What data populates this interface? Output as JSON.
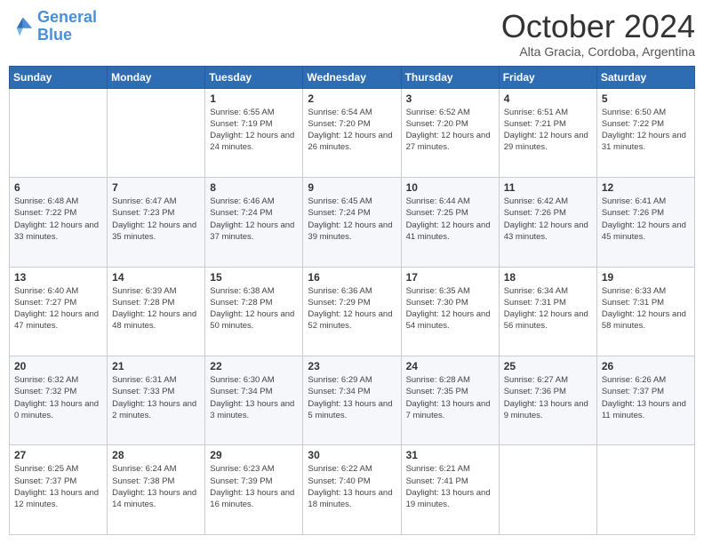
{
  "logo": {
    "line1": "General",
    "line2": "Blue"
  },
  "header": {
    "month": "October 2024",
    "location": "Alta Gracia, Cordoba, Argentina"
  },
  "weekdays": [
    "Sunday",
    "Monday",
    "Tuesday",
    "Wednesday",
    "Thursday",
    "Friday",
    "Saturday"
  ],
  "weeks": [
    [
      {
        "day": "",
        "info": ""
      },
      {
        "day": "",
        "info": ""
      },
      {
        "day": "1",
        "info": "Sunrise: 6:55 AM\nSunset: 7:19 PM\nDaylight: 12 hours and 24 minutes."
      },
      {
        "day": "2",
        "info": "Sunrise: 6:54 AM\nSunset: 7:20 PM\nDaylight: 12 hours and 26 minutes."
      },
      {
        "day": "3",
        "info": "Sunrise: 6:52 AM\nSunset: 7:20 PM\nDaylight: 12 hours and 27 minutes."
      },
      {
        "day": "4",
        "info": "Sunrise: 6:51 AM\nSunset: 7:21 PM\nDaylight: 12 hours and 29 minutes."
      },
      {
        "day": "5",
        "info": "Sunrise: 6:50 AM\nSunset: 7:22 PM\nDaylight: 12 hours and 31 minutes."
      }
    ],
    [
      {
        "day": "6",
        "info": "Sunrise: 6:48 AM\nSunset: 7:22 PM\nDaylight: 12 hours and 33 minutes."
      },
      {
        "day": "7",
        "info": "Sunrise: 6:47 AM\nSunset: 7:23 PM\nDaylight: 12 hours and 35 minutes."
      },
      {
        "day": "8",
        "info": "Sunrise: 6:46 AM\nSunset: 7:24 PM\nDaylight: 12 hours and 37 minutes."
      },
      {
        "day": "9",
        "info": "Sunrise: 6:45 AM\nSunset: 7:24 PM\nDaylight: 12 hours and 39 minutes."
      },
      {
        "day": "10",
        "info": "Sunrise: 6:44 AM\nSunset: 7:25 PM\nDaylight: 12 hours and 41 minutes."
      },
      {
        "day": "11",
        "info": "Sunrise: 6:42 AM\nSunset: 7:26 PM\nDaylight: 12 hours and 43 minutes."
      },
      {
        "day": "12",
        "info": "Sunrise: 6:41 AM\nSunset: 7:26 PM\nDaylight: 12 hours and 45 minutes."
      }
    ],
    [
      {
        "day": "13",
        "info": "Sunrise: 6:40 AM\nSunset: 7:27 PM\nDaylight: 12 hours and 47 minutes."
      },
      {
        "day": "14",
        "info": "Sunrise: 6:39 AM\nSunset: 7:28 PM\nDaylight: 12 hours and 48 minutes."
      },
      {
        "day": "15",
        "info": "Sunrise: 6:38 AM\nSunset: 7:28 PM\nDaylight: 12 hours and 50 minutes."
      },
      {
        "day": "16",
        "info": "Sunrise: 6:36 AM\nSunset: 7:29 PM\nDaylight: 12 hours and 52 minutes."
      },
      {
        "day": "17",
        "info": "Sunrise: 6:35 AM\nSunset: 7:30 PM\nDaylight: 12 hours and 54 minutes."
      },
      {
        "day": "18",
        "info": "Sunrise: 6:34 AM\nSunset: 7:31 PM\nDaylight: 12 hours and 56 minutes."
      },
      {
        "day": "19",
        "info": "Sunrise: 6:33 AM\nSunset: 7:31 PM\nDaylight: 12 hours and 58 minutes."
      }
    ],
    [
      {
        "day": "20",
        "info": "Sunrise: 6:32 AM\nSunset: 7:32 PM\nDaylight: 13 hours and 0 minutes."
      },
      {
        "day": "21",
        "info": "Sunrise: 6:31 AM\nSunset: 7:33 PM\nDaylight: 13 hours and 2 minutes."
      },
      {
        "day": "22",
        "info": "Sunrise: 6:30 AM\nSunset: 7:34 PM\nDaylight: 13 hours and 3 minutes."
      },
      {
        "day": "23",
        "info": "Sunrise: 6:29 AM\nSunset: 7:34 PM\nDaylight: 13 hours and 5 minutes."
      },
      {
        "day": "24",
        "info": "Sunrise: 6:28 AM\nSunset: 7:35 PM\nDaylight: 13 hours and 7 minutes."
      },
      {
        "day": "25",
        "info": "Sunrise: 6:27 AM\nSunset: 7:36 PM\nDaylight: 13 hours and 9 minutes."
      },
      {
        "day": "26",
        "info": "Sunrise: 6:26 AM\nSunset: 7:37 PM\nDaylight: 13 hours and 11 minutes."
      }
    ],
    [
      {
        "day": "27",
        "info": "Sunrise: 6:25 AM\nSunset: 7:37 PM\nDaylight: 13 hours and 12 minutes."
      },
      {
        "day": "28",
        "info": "Sunrise: 6:24 AM\nSunset: 7:38 PM\nDaylight: 13 hours and 14 minutes."
      },
      {
        "day": "29",
        "info": "Sunrise: 6:23 AM\nSunset: 7:39 PM\nDaylight: 13 hours and 16 minutes."
      },
      {
        "day": "30",
        "info": "Sunrise: 6:22 AM\nSunset: 7:40 PM\nDaylight: 13 hours and 18 minutes."
      },
      {
        "day": "31",
        "info": "Sunrise: 6:21 AM\nSunset: 7:41 PM\nDaylight: 13 hours and 19 minutes."
      },
      {
        "day": "",
        "info": ""
      },
      {
        "day": "",
        "info": ""
      }
    ]
  ]
}
